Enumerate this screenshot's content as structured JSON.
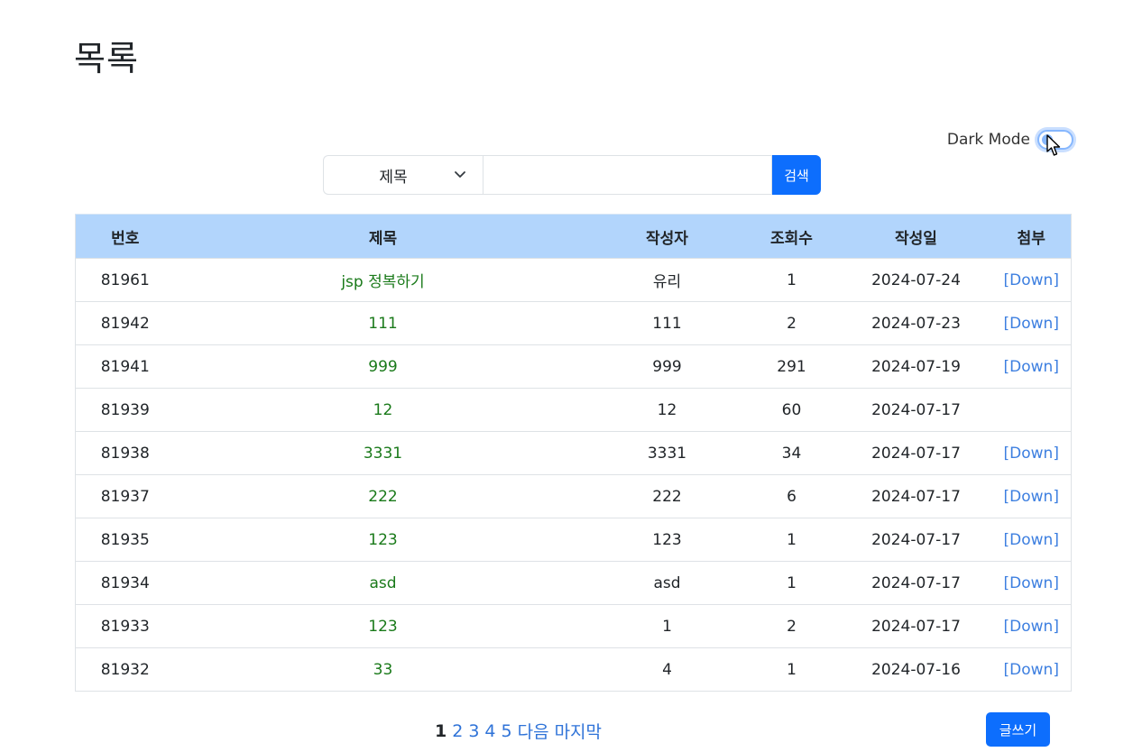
{
  "page": {
    "title": "목록"
  },
  "dark_mode": {
    "label": "Dark Mode",
    "enabled": false
  },
  "search": {
    "field_selected": "제목",
    "query": "",
    "button_label": "검색"
  },
  "table": {
    "headers": [
      "번호",
      "제목",
      "작성자",
      "조회수",
      "작성일",
      "첨부"
    ],
    "rows": [
      {
        "no": "81961",
        "title": "jsp 정복하기",
        "author": "유리",
        "views": "1",
        "date": "2024-07-24",
        "attach": "[Down]"
      },
      {
        "no": "81942",
        "title": "111",
        "author": "111",
        "views": "2",
        "date": "2024-07-23",
        "attach": "[Down]"
      },
      {
        "no": "81941",
        "title": "999",
        "author": "999",
        "views": "291",
        "date": "2024-07-19",
        "attach": "[Down]"
      },
      {
        "no": "81939",
        "title": "12",
        "author": "12",
        "views": "60",
        "date": "2024-07-17",
        "attach": ""
      },
      {
        "no": "81938",
        "title": "3331",
        "author": "3331",
        "views": "34",
        "date": "2024-07-17",
        "attach": "[Down]"
      },
      {
        "no": "81937",
        "title": "222",
        "author": "222",
        "views": "6",
        "date": "2024-07-17",
        "attach": "[Down]"
      },
      {
        "no": "81935",
        "title": "123",
        "author": "123",
        "views": "1",
        "date": "2024-07-17",
        "attach": "[Down]"
      },
      {
        "no": "81934",
        "title": "asd",
        "author": "asd",
        "views": "1",
        "date": "2024-07-17",
        "attach": "[Down]"
      },
      {
        "no": "81933",
        "title": "123",
        "author": "1",
        "views": "2",
        "date": "2024-07-17",
        "attach": "[Down]"
      },
      {
        "no": "81932",
        "title": "33",
        "author": "4",
        "views": "1",
        "date": "2024-07-16",
        "attach": "[Down]"
      }
    ]
  },
  "pagination": {
    "current": "1",
    "pages": [
      "2",
      "3",
      "4",
      "5"
    ],
    "next_label": "다음",
    "last_label": "마지막"
  },
  "write_button": {
    "label": "글쓰기"
  },
  "colors": {
    "header_bg": "#b2d5fc",
    "primary": "#0d6efd",
    "title_link": "#1a7a1a",
    "down_link": "#3d7fe0"
  }
}
